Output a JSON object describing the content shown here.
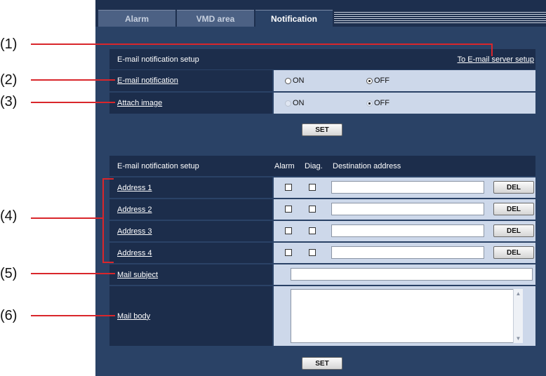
{
  "callouts": [
    "(1)",
    "(2)",
    "(3)",
    "(4)",
    "(5)",
    "(6)"
  ],
  "tabs": [
    {
      "label": "Alarm",
      "active": false
    },
    {
      "label": "VMD area",
      "active": false
    },
    {
      "label": "Notification",
      "active": true
    }
  ],
  "setup": {
    "title": "E-mail notification setup",
    "server_link": "To E-mail server setup",
    "email_notification": {
      "label": "E-mail notification",
      "on": "ON",
      "off": "OFF",
      "selected": "OFF"
    },
    "attach_image": {
      "label": "Attach image",
      "on": "ON",
      "off": "OFF",
      "disabled": true
    },
    "set_label": "SET"
  },
  "dest": {
    "title": "E-mail notification setup",
    "col_alarm": "Alarm",
    "col_diag": "Diag.",
    "col_dest": "Destination address",
    "addresses": [
      {
        "label": "Address 1",
        "value": ""
      },
      {
        "label": "Address 2",
        "value": ""
      },
      {
        "label": "Address 3",
        "value": ""
      },
      {
        "label": "Address 4",
        "value": ""
      }
    ],
    "del_label": "DEL",
    "mail_subject": "Mail subject",
    "mail_subject_value": "",
    "mail_body": "Mail body",
    "mail_body_value": "",
    "set_label": "SET"
  },
  "colors": {
    "accent": "#d9262b",
    "panel": "#2a4266",
    "header": "#1c2d4b",
    "field": "#cdd8ea"
  }
}
